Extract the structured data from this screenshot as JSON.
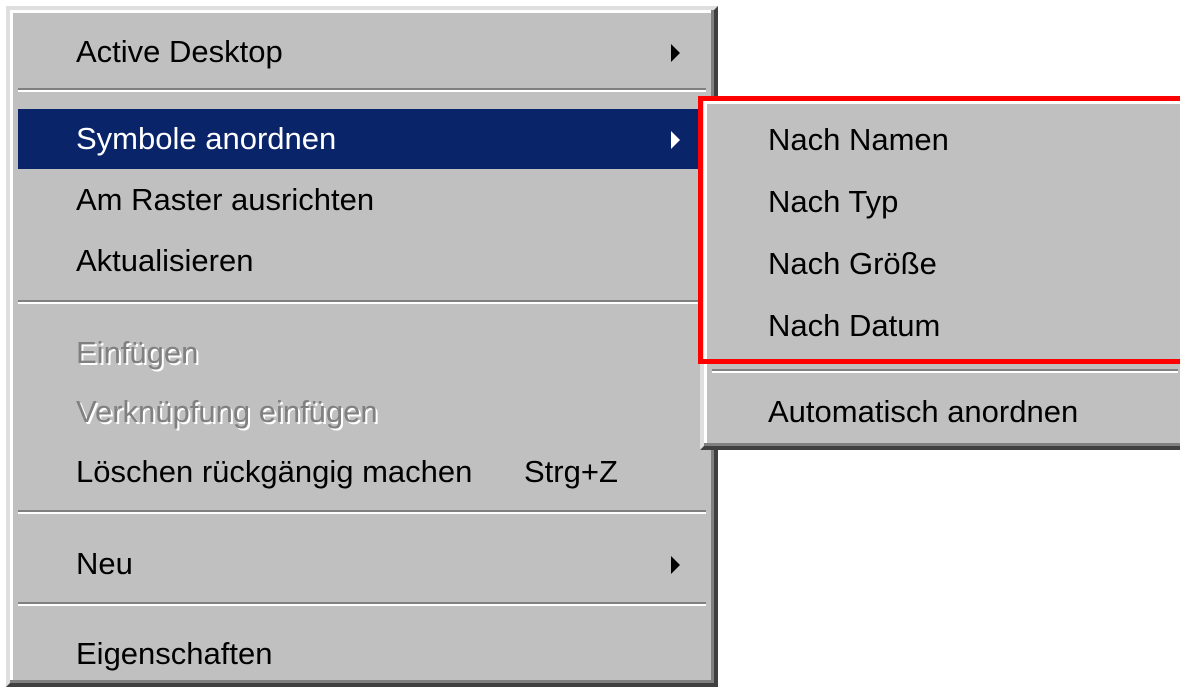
{
  "context_menu": {
    "items": [
      {
        "label": "Active Desktop",
        "has_submenu": true
      },
      {
        "label": "Symbole anordnen",
        "has_submenu": true,
        "highlighted": true
      },
      {
        "label": "Am Raster ausrichten"
      },
      {
        "label": "Aktualisieren"
      },
      {
        "label": "Einfügen",
        "disabled": true
      },
      {
        "label": "Verknüpfung einfügen",
        "disabled": true
      },
      {
        "label": "Löschen rückgängig machen",
        "shortcut": "Strg+Z"
      },
      {
        "label": "Neu",
        "has_submenu": true
      },
      {
        "label": "Eigenschaften"
      }
    ]
  },
  "submenu": {
    "items": [
      {
        "label": "Nach Namen"
      },
      {
        "label": "Nach Typ"
      },
      {
        "label": "Nach Größe"
      },
      {
        "label": "Nach Datum"
      },
      {
        "label": "Automatisch anordnen"
      }
    ]
  },
  "colors": {
    "menu_background": "#c0c0c0",
    "highlight": "#0a246a",
    "disabled_text": "#808080",
    "annotation_box": "#ff0000"
  }
}
